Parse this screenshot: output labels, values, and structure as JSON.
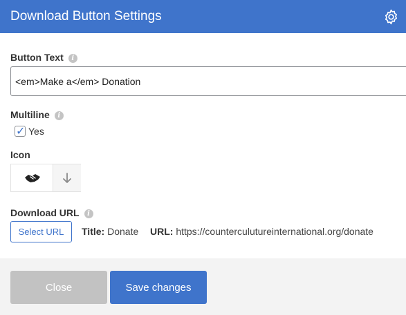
{
  "header": {
    "title": "Download Button Settings",
    "settings_icon": "gear-icon"
  },
  "button_text": {
    "label": "Button Text",
    "value": "<em>Make a</em> Donation",
    "info_icon": "info-icon"
  },
  "multiline": {
    "label": "Multiline",
    "checkbox_label": "Yes",
    "checked": true,
    "info_icon": "info-icon"
  },
  "icon": {
    "label": "Icon",
    "options": [
      "handshake-icon",
      "arrow-down-icon"
    ],
    "selected": "handshake-icon"
  },
  "download_url": {
    "label": "Download URL",
    "info_icon": "info-icon",
    "select_button": "Select URL",
    "title_label": "Title:",
    "title_value": "Donate",
    "url_label": "URL:",
    "url_value": "https://counterculutureinternational.org/donate"
  },
  "footer": {
    "close_label": "Close",
    "save_label": "Save changes"
  },
  "colors": {
    "accent": "#3f74cb",
    "disabled": "#c2c2c2",
    "footer_bg": "#f3f3f3"
  }
}
